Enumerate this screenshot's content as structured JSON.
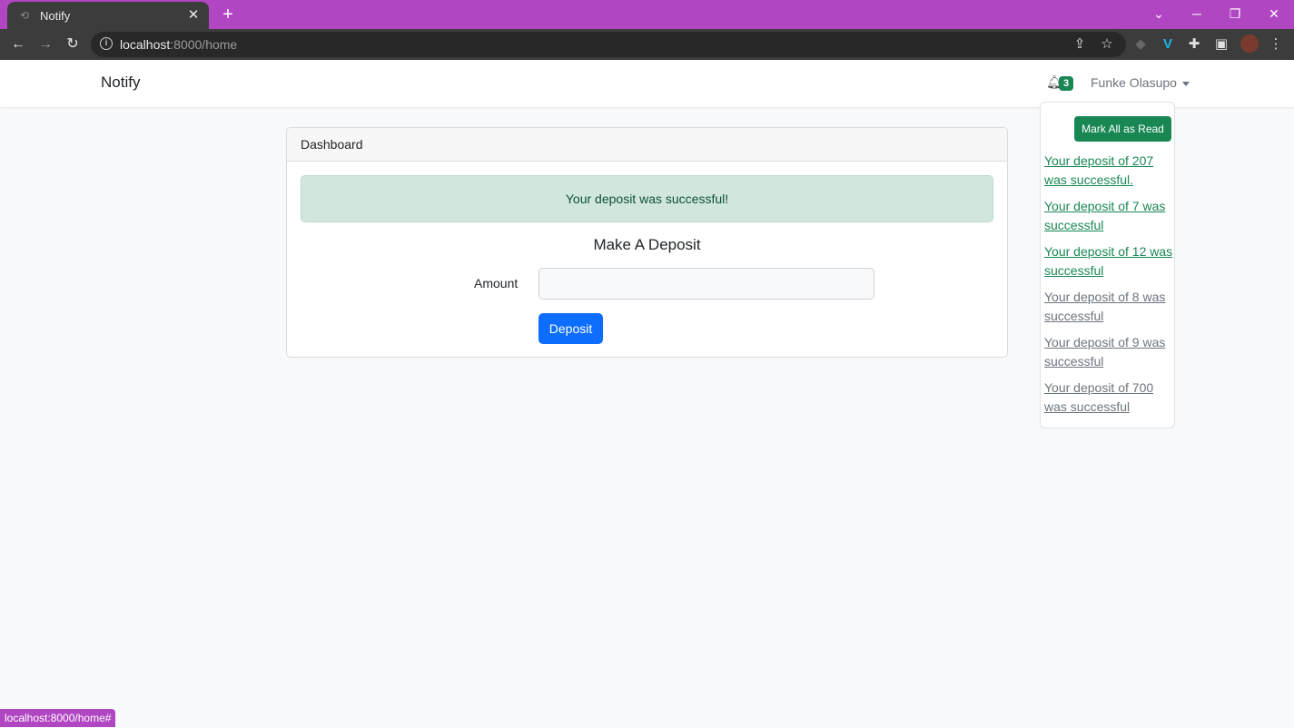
{
  "browser": {
    "tab_title": "Notify",
    "url_host": "localhost",
    "url_rest": ":8000/home",
    "status_url": "localhost:8000/home#"
  },
  "navbar": {
    "brand": "Notify",
    "notification_count": "3",
    "user_name": "Funke Olasupo"
  },
  "dropdown": {
    "mark_all_label": "Mark All as Read",
    "items": [
      {
        "text": "Your deposit of 207 was successful.",
        "read": false
      },
      {
        "text": "Your deposit of 7 was successful",
        "read": false
      },
      {
        "text": "Your deposit of 12 was successful",
        "read": false
      },
      {
        "text": "Your deposit of 8 was successful",
        "read": true
      },
      {
        "text": "Your deposit of 9 was successful",
        "read": true
      },
      {
        "text": "Your deposit of 700 was successful",
        "read": true
      }
    ]
  },
  "card": {
    "header": "Dashboard",
    "alert": "Your deposit was successful!",
    "section_title": "Make A Deposit",
    "amount_label": "Amount",
    "amount_value": "",
    "deposit_label": "Deposit"
  },
  "colors": {
    "tabstrip": "#b146c2",
    "success": "#198754",
    "primary": "#0d6efd"
  }
}
